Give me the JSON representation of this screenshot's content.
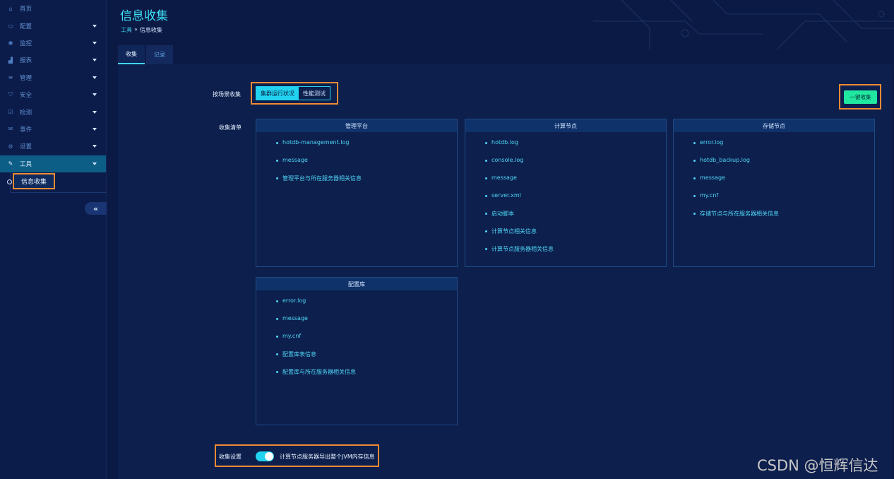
{
  "sidebar": {
    "items": [
      {
        "label": "首页",
        "icon": "home-icon",
        "glyph": "⌂"
      },
      {
        "label": "配置",
        "icon": "monitor-icon",
        "glyph": "▭"
      },
      {
        "label": "监控",
        "icon": "eye-icon",
        "glyph": "◉"
      },
      {
        "label": "报表",
        "icon": "chart-icon",
        "glyph": "▟"
      },
      {
        "label": "管理",
        "icon": "database-icon",
        "glyph": "≡"
      },
      {
        "label": "安全",
        "icon": "shield-icon",
        "glyph": "⛉"
      },
      {
        "label": "检测",
        "icon": "checkbox-icon",
        "glyph": "☑"
      },
      {
        "label": "事件",
        "icon": "envelope-icon",
        "glyph": "✉"
      },
      {
        "label": "设置",
        "icon": "gear-icon",
        "glyph": "⚙"
      },
      {
        "label": "工具",
        "icon": "wrench-icon",
        "glyph": "✎"
      }
    ],
    "sub_item": "信息收集",
    "collapse_glyph": "«"
  },
  "header": {
    "title": "信息收集",
    "breadcrumb": {
      "parent": "工具",
      "separator": "»",
      "current": "信息收集"
    }
  },
  "tabs": [
    "收集",
    "记录"
  ],
  "main": {
    "scene_label": "按场景收集",
    "scene_options": [
      "集群运行状况",
      "性能测试"
    ],
    "collect_button": "一键收集",
    "list_label": "收集清单",
    "cards": [
      {
        "title": "管理平台",
        "items": [
          "hotdb-management.log",
          "message",
          "管理平台与所在服务器相关信息"
        ]
      },
      {
        "title": "计算节点",
        "items": [
          "hotdb.log",
          "console.log",
          "message",
          "server.xml",
          "启动脚本",
          "计算节点相关信息",
          "计算节点服务器相关信息"
        ]
      },
      {
        "title": "存储节点",
        "items": [
          "error.log",
          "hotdb_backup.log",
          "message",
          "my.cnf",
          "存储节点与所在服务器相关信息"
        ]
      },
      {
        "title": "配置库",
        "items": [
          "error.log",
          "message",
          "my.cnf",
          "配置库表信息",
          "配置库与所在服务器相关信息"
        ]
      }
    ],
    "settings_label": "收集设置",
    "toggle_on": true,
    "toggle_text": "计算节点服务器导出整个JVM内存信息"
  },
  "watermark": "CSDN @恒辉信达",
  "colors": {
    "accent": "#22d3f0",
    "highlight": "#f08a36",
    "button": "#20e8a0",
    "background": "#0b1a45"
  }
}
